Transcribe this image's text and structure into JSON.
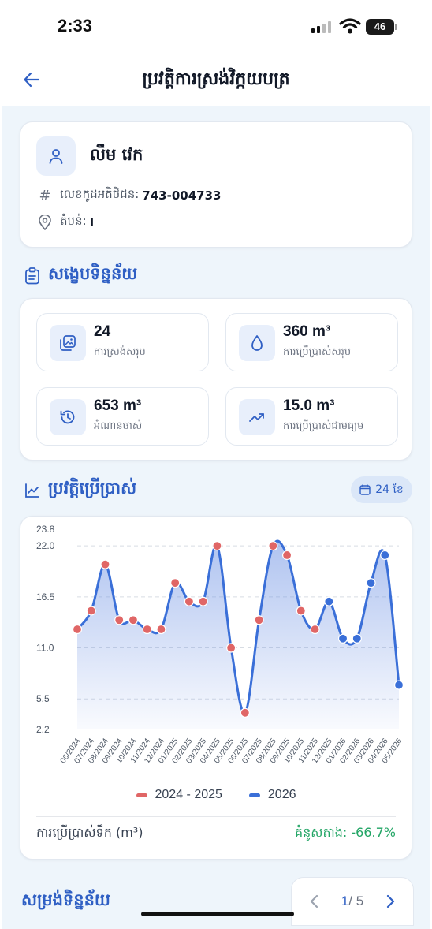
{
  "status": {
    "time": "2:33",
    "battery": "46"
  },
  "header": {
    "title": "ប្រវត្តិការស្រង់វិក្កយបត្រ"
  },
  "profile": {
    "name": "លឹម វេក",
    "code_label": "លេខកូដអតិថិជន:",
    "code_value": "743-004733",
    "area_label": "តំបន់:",
    "area_value": "I"
  },
  "summary": {
    "title": "សង្ខេបទិន្នន័យ",
    "stats": [
      {
        "value": "24",
        "label": "ការស្រង់សរុប",
        "icon": "image-gallery-icon"
      },
      {
        "value": "360 m³",
        "label": "ការប្រើប្រាស់សរុប",
        "icon": "water-drop-icon"
      },
      {
        "value": "653 m³",
        "label": "អំណានចាស់",
        "icon": "history-icon"
      },
      {
        "value": "15.0 m³",
        "label": "ការប្រើប្រាស់ជាមធ្យម",
        "icon": "trend-up-icon"
      }
    ]
  },
  "history": {
    "title": "ប្រវត្តិប្រើប្រាស់",
    "period": "24 ខែ"
  },
  "chart_data": {
    "type": "line",
    "categories": [
      "06/2024",
      "07/2024",
      "08/2024",
      "09/2024",
      "10/2024",
      "11/2024",
      "12/2024",
      "01/2025",
      "02/2025",
      "03/2025",
      "04/2025",
      "05/2025",
      "06/2025",
      "07/2025",
      "08/2025",
      "09/2025",
      "10/2025",
      "11/2025",
      "12/2025",
      "01/2026",
      "02/2026",
      "03/2026",
      "04/2026",
      "05/2026"
    ],
    "y_ticks": [
      "23.8",
      "22.0",
      "16.5",
      "11.0",
      "5.5",
      "2.2"
    ],
    "ylim": [
      2.2,
      23.8
    ],
    "series": [
      {
        "name": "2024 - 2025",
        "color": "#e06666",
        "values": [
          13,
          15,
          20,
          14,
          14,
          13,
          13,
          18,
          16,
          16,
          22,
          11,
          4,
          14,
          22,
          21,
          15,
          13,
          16,
          null,
          null,
          null,
          null,
          null
        ]
      },
      {
        "name": "2026",
        "color": "#3a6fd8",
        "values": [
          null,
          null,
          null,
          null,
          null,
          null,
          null,
          null,
          null,
          null,
          null,
          null,
          null,
          null,
          null,
          null,
          null,
          null,
          16,
          12,
          12,
          18,
          21,
          7
        ]
      }
    ],
    "all_values": [
      13,
      15,
      20,
      14,
      14,
      13,
      13,
      18,
      16,
      16,
      22,
      11,
      4,
      14,
      22,
      21,
      15,
      13,
      16,
      12,
      12,
      18,
      21,
      7
    ],
    "unit_label": "ការប្រើប្រាស់ទឹក (m³)",
    "compare_label": "គំនូសតាង: -66.7%",
    "grid": true,
    "legend_position": "bottom"
  },
  "bottom": {
    "title": "សម្រង់ទិន្នន័យ",
    "pager_current": "1",
    "pager_total": "/ 5"
  }
}
